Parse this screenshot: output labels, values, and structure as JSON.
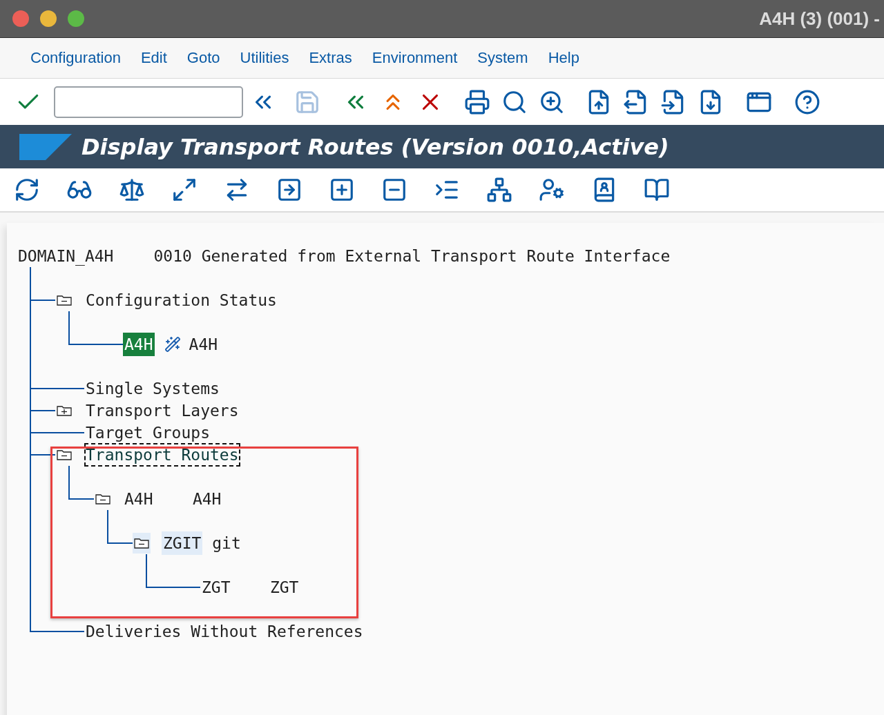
{
  "window": {
    "title": "A4H (3) (001) -"
  },
  "menu": [
    "Configuration",
    "Edit",
    "Goto",
    "Utilities",
    "Extras",
    "Environment",
    "System",
    "Help"
  ],
  "page_title": "Display Transport Routes (Version 0010,Active)",
  "tree": {
    "root": {
      "label": "DOMAIN_A4H",
      "description": "0010 Generated from External Transport Route Interface"
    },
    "children": [
      {
        "kind": "folder",
        "label": "Configuration Status",
        "expanded": true,
        "selected": false,
        "focused": false,
        "children": [
          {
            "kind": "system",
            "label": "A4H",
            "description": "A4H",
            "selected": false,
            "focused": false
          }
        ]
      },
      {
        "kind": "leaf",
        "label": "Single Systems",
        "selected": false,
        "focused": false
      },
      {
        "kind": "folder",
        "label": "Transport Layers",
        "expanded": false,
        "selected": false,
        "focused": false
      },
      {
        "kind": "leaf",
        "label": "Target Groups",
        "selected": false,
        "focused": false
      },
      {
        "kind": "folder",
        "label": "Transport Routes",
        "expanded": true,
        "selected": false,
        "focused": true,
        "children": [
          {
            "kind": "folder",
            "label": "A4H",
            "description": "A4H",
            "expanded": true,
            "selected": false,
            "focused": false,
            "children": [
              {
                "kind": "folder",
                "label": "ZGIT",
                "description": "git",
                "expanded": true,
                "selected": true,
                "focused": false,
                "children": [
                  {
                    "kind": "leaf",
                    "label": "ZGT",
                    "description": "ZGT",
                    "selected": false,
                    "focused": false
                  }
                ]
              }
            ]
          }
        ]
      },
      {
        "kind": "leaf",
        "label": "Deliveries Without References",
        "selected": false,
        "focused": false
      }
    ]
  },
  "highlight_frame": true
}
